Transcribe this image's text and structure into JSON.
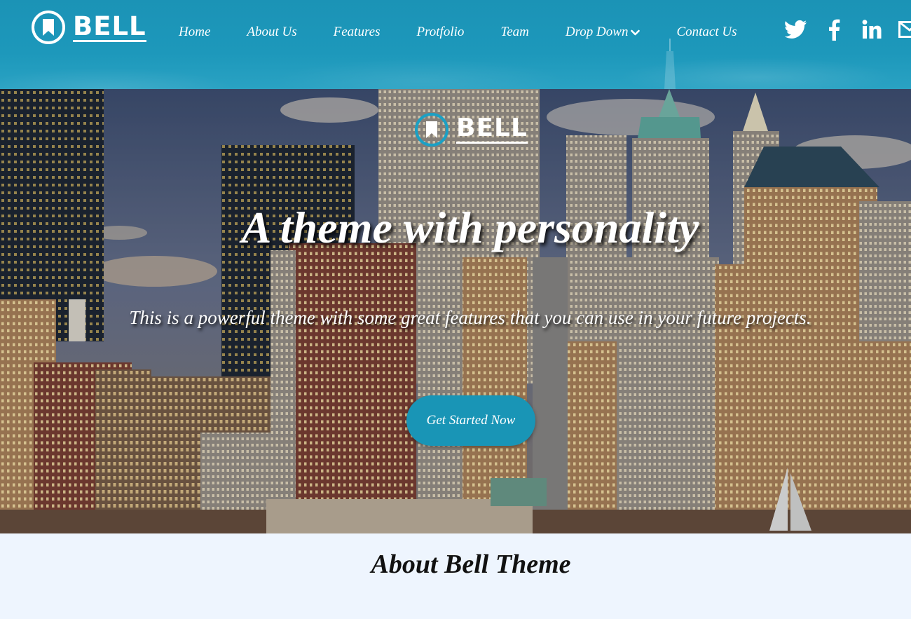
{
  "brand": {
    "name": "BELL",
    "accent_color": "#1b95b8",
    "logo_icon": "bookmark-circle-icon"
  },
  "nav": {
    "items": [
      {
        "label": "Home"
      },
      {
        "label": "About Us"
      },
      {
        "label": "Features"
      },
      {
        "label": "Protfolio"
      },
      {
        "label": "Team"
      },
      {
        "label": "Drop Down",
        "icon": "chevron-down-icon"
      },
      {
        "label": "Contact Us"
      }
    ]
  },
  "social": {
    "icons": [
      "twitter-icon",
      "facebook-icon",
      "linkedin-icon",
      "envelope-icon"
    ]
  },
  "hero": {
    "logo_text": "BELL",
    "title": "A theme with personality",
    "subtitle": "This is a powerful theme with some great features that you can use in your future projects.",
    "cta_label": "Get Started Now",
    "cta_color": "#1995b6"
  },
  "about": {
    "title": "About Bell Theme"
  }
}
